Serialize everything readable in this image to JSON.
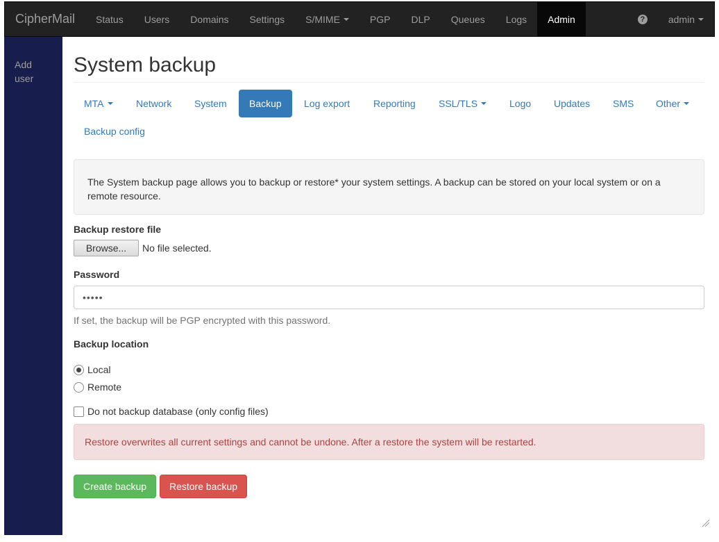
{
  "navbar": {
    "brand": "CipherMail",
    "items": [
      {
        "label": "Status"
      },
      {
        "label": "Users"
      },
      {
        "label": "Domains"
      },
      {
        "label": "Settings"
      },
      {
        "label": "S/MIME"
      },
      {
        "label": "PGP"
      },
      {
        "label": "DLP"
      },
      {
        "label": "Queues"
      },
      {
        "label": "Logs"
      },
      {
        "label": "Admin"
      }
    ],
    "active_item": "Admin",
    "help_icon": "question-circle-icon",
    "help_glyph": "?",
    "user_menu": "admin"
  },
  "sidebar": {
    "items": [
      {
        "label": "Add user"
      }
    ]
  },
  "page": {
    "title": "System backup"
  },
  "tabs": [
    {
      "label": "MTA",
      "dropdown": true
    },
    {
      "label": "Network"
    },
    {
      "label": "System"
    },
    {
      "label": "Backup",
      "active": true
    },
    {
      "label": "Log export"
    },
    {
      "label": "Reporting"
    },
    {
      "label": "SSL/TLS",
      "dropdown": true
    },
    {
      "label": "Logo"
    },
    {
      "label": "Updates"
    },
    {
      "label": "SMS"
    },
    {
      "label": "Other",
      "dropdown": true
    },
    {
      "label": "Backup config"
    }
  ],
  "info": {
    "text": "The System backup page allows you to backup or restore* your system settings. A backup can be stored on your local system or on a remote resource."
  },
  "form": {
    "restore_file": {
      "label": "Backup restore file",
      "button_label": "Browse...",
      "status": "No file selected."
    },
    "password": {
      "label": "Password",
      "value": "•••••",
      "help": "If set, the backup will be PGP encrypted with this password."
    },
    "location": {
      "label": "Backup location",
      "options": [
        {
          "label": "Local",
          "checked": true
        },
        {
          "label": "Remote",
          "checked": false
        }
      ]
    },
    "skip_database": {
      "label": "Do not backup database (only config files)",
      "checked": false
    }
  },
  "warning": {
    "text": "Restore overwrites all current settings and cannot be undone. After a restore the system will be restarted."
  },
  "actions": {
    "create_label": "Create backup",
    "restore_label": "Restore backup"
  },
  "colors": {
    "navbar_bg": "#222222",
    "sidebar_bg": "#171e4d",
    "link": "#337ab7",
    "active_tab": "#337ab7",
    "success": "#5cb85c",
    "danger": "#d9534f",
    "alert_bg": "#f2dede",
    "alert_text": "#a94442"
  }
}
